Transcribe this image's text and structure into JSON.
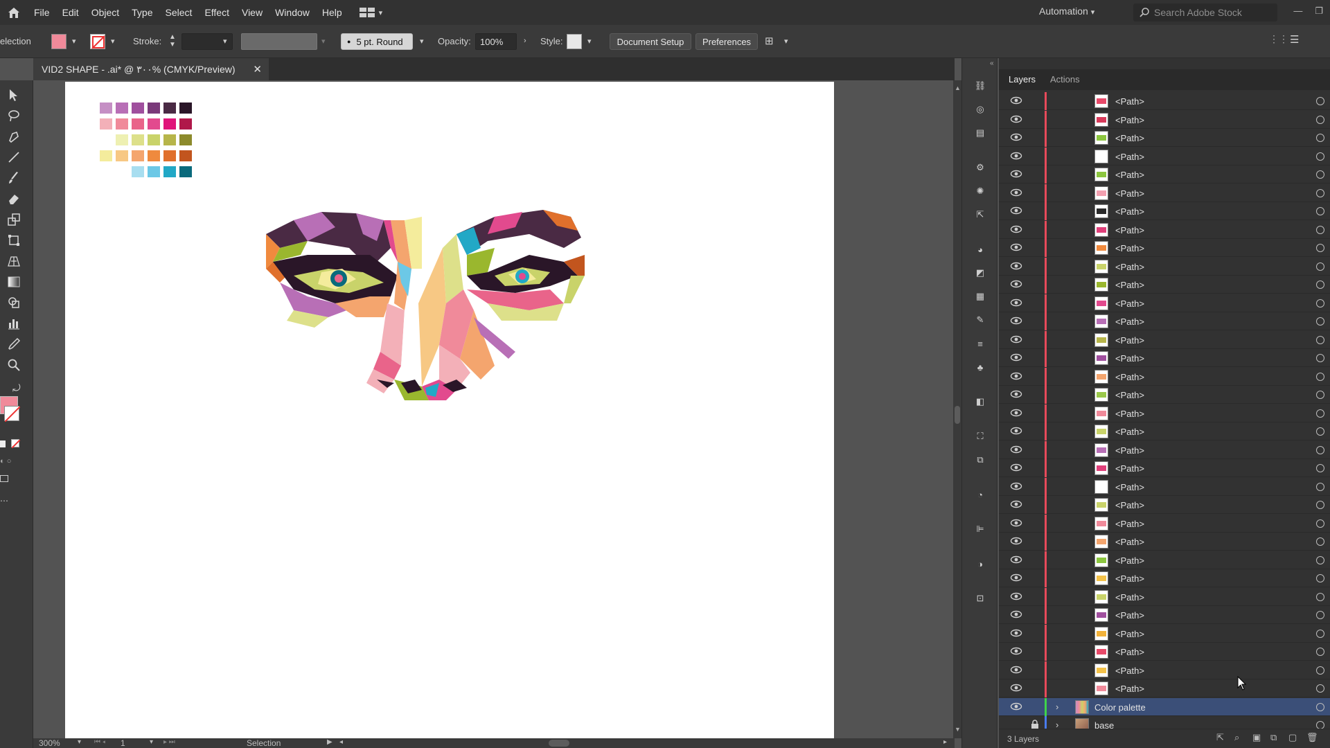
{
  "menubar": {
    "items": [
      "File",
      "Edit",
      "Object",
      "Type",
      "Select",
      "Effect",
      "View",
      "Window",
      "Help"
    ],
    "automation": "Automation",
    "search_placeholder": "Search Adobe Stock"
  },
  "control": {
    "selection_label": "election",
    "stroke_label": "Stroke:",
    "brush": "5 pt. Round",
    "opacity_label": "Opacity:",
    "opacity_value": "100%",
    "style_label": "Style:",
    "doc_setup": "Document Setup",
    "preferences": "Preferences",
    "fill_color": "#f08a9a"
  },
  "document": {
    "tab_title": "VID2 SHAPE - .ai* @ ٣٠٠% (CMYK/Preview)"
  },
  "status": {
    "zoom": "300%",
    "page": "1",
    "tool": "Selection"
  },
  "palette": {
    "rows": [
      [
        "#c58fc4",
        "#b86fb6",
        "#a04f9e",
        "#7a3a7a",
        "#4a2a44",
        "#2a1628"
      ],
      [
        "#f3b0b8",
        "#f08a9a",
        "#e9648a",
        "#e24a8e",
        "#e0147a",
        "#b0184a"
      ],
      [
        "",
        "#eef0b2",
        "#dde08a",
        "#c9d36a",
        "#b7b54a",
        "#8c8a2c"
      ],
      [
        "#f4ec9c",
        "#f7c884",
        "#f4a56e",
        "#ef8a3e",
        "#e0702c",
        "#c2551e"
      ],
      [
        "",
        "",
        "#a8def0",
        "#6cc8e6",
        "#22a8c6",
        "#0a6a7c"
      ]
    ]
  },
  "layers": {
    "tab_layers": "Layers",
    "tab_actions": "Actions",
    "path_label": "<Path>",
    "path_thumbs": [
      "#e84a6a",
      "#d83a5a",
      "#8cc63f",
      "#ffffff",
      "#8cc63f",
      "#f2a0b0",
      "#2a2a2a",
      "#e0407a",
      "#f08a3e",
      "#c9d36a",
      "#9ab72e",
      "#e24a8e",
      "#b86fb6",
      "#b7b54a",
      "#a04f9e",
      "#f4a56e",
      "#9ac84a",
      "#f08a9a",
      "#c9d36a",
      "#b86fb6",
      "#e0407a",
      "#ffffff",
      "#c9d36a",
      "#f08a9a",
      "#f4a56e",
      "#8cc63f",
      "#f4c24a",
      "#c9d36a",
      "#a04f9e",
      "#f2b23a",
      "#e84a6a",
      "#f4c24a",
      "#f08a9a"
    ],
    "color_palette_label": "Color palette",
    "base_label": "base",
    "footer_count": "3 Layers"
  }
}
